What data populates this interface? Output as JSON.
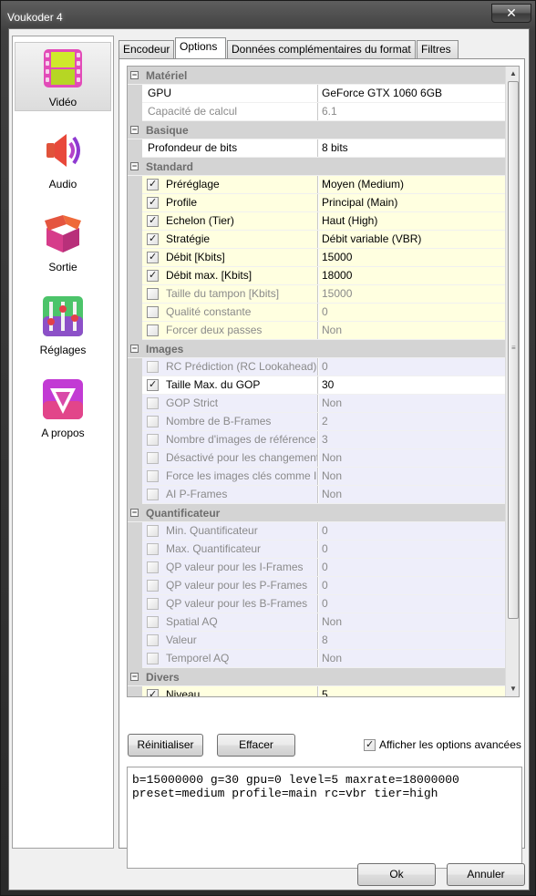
{
  "window": {
    "title": "Voukoder 4",
    "close_glyph": "✕"
  },
  "sidebar": {
    "items": [
      {
        "label": "Vidéo",
        "icon": "film-icon",
        "selected": true
      },
      {
        "label": "Audio",
        "icon": "speaker-icon",
        "selected": false
      },
      {
        "label": "Sortie",
        "icon": "box-icon",
        "selected": false
      },
      {
        "label": "Réglages",
        "icon": "sliders-icon",
        "selected": false
      },
      {
        "label": "A propos",
        "icon": "voukoder-logo-icon",
        "selected": false
      }
    ]
  },
  "tabs": [
    {
      "label": "Encodeur",
      "active": false
    },
    {
      "label": "Options",
      "active": true
    },
    {
      "label": "Données complémentaires du format",
      "active": false
    },
    {
      "label": "Filtres",
      "active": false
    }
  ],
  "grid": {
    "rows": [
      {
        "kind": "cat",
        "name": "Matériel"
      },
      {
        "kind": "plain",
        "name": "GPU",
        "value": "GeForce GTX 1060 6GB"
      },
      {
        "kind": "plain-ro",
        "name": "Capacité de calcul",
        "value": "6.1"
      },
      {
        "kind": "cat",
        "name": "Basique"
      },
      {
        "kind": "plain",
        "name": "Profondeur de bits",
        "value": "8 bits"
      },
      {
        "kind": "cat",
        "name": "Standard"
      },
      {
        "kind": "hl",
        "checked": true,
        "name": "Préréglage",
        "value": "Moyen (Medium)"
      },
      {
        "kind": "hl",
        "checked": true,
        "name": "Profile",
        "value": "Principal (Main)"
      },
      {
        "kind": "hl",
        "checked": true,
        "name": "Echelon (Tier)",
        "value": "Haut (High)"
      },
      {
        "kind": "hl",
        "checked": true,
        "name": "Stratégie",
        "value": "Débit variable (VBR)"
      },
      {
        "kind": "hl",
        "checked": true,
        "name": "Débit [Kbits]",
        "value": "15000"
      },
      {
        "kind": "hl",
        "checked": true,
        "name": "Débit max. [Kbits]",
        "value": "18000"
      },
      {
        "kind": "hl-dis",
        "checked": false,
        "name": "Taille du tampon [Kbits]",
        "value": "15000"
      },
      {
        "kind": "hl-dis",
        "checked": false,
        "name": "Qualité constante",
        "value": "0"
      },
      {
        "kind": "hl-dis",
        "checked": false,
        "name": "Forcer deux passes",
        "value": "Non"
      },
      {
        "kind": "cat",
        "name": "Images"
      },
      {
        "kind": "dis",
        "checked": false,
        "name": "RC Prédiction (RC Lookahead)",
        "value": "0"
      },
      {
        "kind": "on",
        "checked": true,
        "name": "Taille Max. du GOP",
        "value": "30"
      },
      {
        "kind": "dis",
        "checked": false,
        "name": "GOP Strict",
        "value": "Non"
      },
      {
        "kind": "dis",
        "checked": false,
        "name": "Nombre de B-Frames",
        "value": "2"
      },
      {
        "kind": "dis",
        "checked": false,
        "name": "Nombre d'images de référence",
        "value": "3"
      },
      {
        "kind": "dis",
        "checked": false,
        "name": "Désactivé pour les changement",
        "value": "Non"
      },
      {
        "kind": "dis",
        "checked": false,
        "name": "Force les images clés comme ID",
        "value": "Non"
      },
      {
        "kind": "dis",
        "checked": false,
        "name": "AI P-Frames",
        "value": "Non"
      },
      {
        "kind": "cat",
        "name": "Quantificateur"
      },
      {
        "kind": "dis",
        "checked": false,
        "name": "Min. Quantificateur",
        "value": "0"
      },
      {
        "kind": "dis",
        "checked": false,
        "name": "Max. Quantificateur",
        "value": "0"
      },
      {
        "kind": "dis",
        "checked": false,
        "name": "QP valeur pour les I-Frames",
        "value": "0"
      },
      {
        "kind": "dis",
        "checked": false,
        "name": "QP valeur pour les P-Frames",
        "value": "0"
      },
      {
        "kind": "dis",
        "checked": false,
        "name": "QP valeur pour les B-Frames",
        "value": "0"
      },
      {
        "kind": "dis",
        "checked": false,
        "name": "Spatial AQ",
        "value": "Non"
      },
      {
        "kind": "dis",
        "checked": false,
        "name": "Valeur",
        "value": "8"
      },
      {
        "kind": "dis",
        "checked": false,
        "name": "Temporel AQ",
        "value": "Non"
      },
      {
        "kind": "cat",
        "name": "Divers"
      },
      {
        "kind": "hl",
        "checked": true,
        "name": "Niveau",
        "value": "5"
      }
    ]
  },
  "buttons": {
    "reset": "Réinitialiser",
    "clear": "Effacer",
    "ok": "Ok",
    "cancel": "Annuler"
  },
  "advanced": {
    "label": "Afficher les options avancées",
    "checked": true
  },
  "command_line": {
    "line1": "b=15000000 g=30 gpu=0 level=5 maxrate=18000000",
    "line2": "preset=medium profile=main rc=vbr tier=high"
  }
}
